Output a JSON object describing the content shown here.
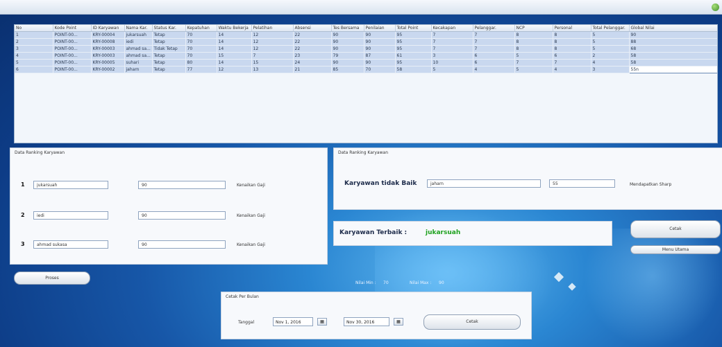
{
  "table": {
    "headers": [
      "No",
      "Kode Point",
      "ID Karyawan",
      "Nama Kar.",
      "Status Kar.",
      "Kepatuhan",
      "Waktu Bekerja",
      "Pelatihan",
      "Absensi",
      "Tes Bersama",
      "Penilaian",
      "Total Point",
      "Kecakapan",
      "Pelanggar.",
      "NCP",
      "Personal",
      "Total Pelanggar.",
      "Global Nilai"
    ],
    "rows": [
      [
        "1",
        "POINT-00...",
        "KRY-00004",
        "jukarsuah",
        "Tetap",
        "70",
        "14",
        "12",
        "22",
        "90",
        "90",
        "95",
        "7",
        "7",
        "8",
        "8",
        "5",
        "90"
      ],
      [
        "2",
        "POINT-00...",
        "KRY-00008",
        "iedi",
        "Tetap",
        "70",
        "14",
        "12",
        "22",
        "90",
        "90",
        "95",
        "7",
        "7",
        "8",
        "8",
        "5",
        "88"
      ],
      [
        "3",
        "POINT-00...",
        "KRY-00003",
        "ahmad sa...",
        "Tidak Tetap",
        "70",
        "14",
        "12",
        "22",
        "90",
        "90",
        "95",
        "7",
        "7",
        "8",
        "8",
        "5",
        "68"
      ],
      [
        "4",
        "POINT-00...",
        "KRY-00003",
        "ahmad sa...",
        "Tetap",
        "70",
        "15",
        "7",
        "23",
        "79",
        "87",
        "61",
        "3",
        "6",
        "5",
        "6",
        "2",
        "58"
      ],
      [
        "5",
        "POINT-00...",
        "KRY-00005",
        "suhari",
        "Tetap",
        "80",
        "14",
        "15",
        "24",
        "90",
        "90",
        "95",
        "10",
        "6",
        "7",
        "7",
        "4",
        "58"
      ],
      [
        "6",
        "POINT-00...",
        "KRY-00002",
        "jaharn",
        "Tetap",
        "77",
        "12",
        "13",
        "21",
        "85",
        "70",
        "58",
        "5",
        "4",
        "5",
        "4",
        "3",
        "55n"
      ]
    ]
  },
  "left_panel": {
    "title": "Data Ranking Karyawan",
    "items": [
      {
        "num": "1",
        "name": "jukarsuah",
        "score": "90",
        "note": "Kenaikan Gaji"
      },
      {
        "num": "2",
        "name": "iedi",
        "score": "90",
        "note": "Kenaikan Gaji"
      },
      {
        "num": "3",
        "name": "ahmad sukasa",
        "score": "90",
        "note": "Kenaikan Gaji"
      }
    ]
  },
  "right_panel": {
    "title": "Data Ranking Karyawan",
    "label": "Karyawan tidak Baik",
    "name": "jaharn",
    "score": "55",
    "note": "Mendapatkan Sharp"
  },
  "best": {
    "label": "Karyawan Terbaik :",
    "name": "jukarsuah"
  },
  "buttons": {
    "proses": "Proses",
    "cetak": "Cetak",
    "menu_utama": "Menu Utama",
    "cetak_period": "Cetak"
  },
  "stats": {
    "min_label": "Nilai Min :",
    "min_value": "70",
    "max_label": "Nilai Max :",
    "max_value": "90"
  },
  "print_panel": {
    "title": "Cetak Per Bulan",
    "tanggal_label": "Tanggal",
    "date_from": "Nov 1, 2016",
    "date_to": "Nov 30, 2016"
  }
}
